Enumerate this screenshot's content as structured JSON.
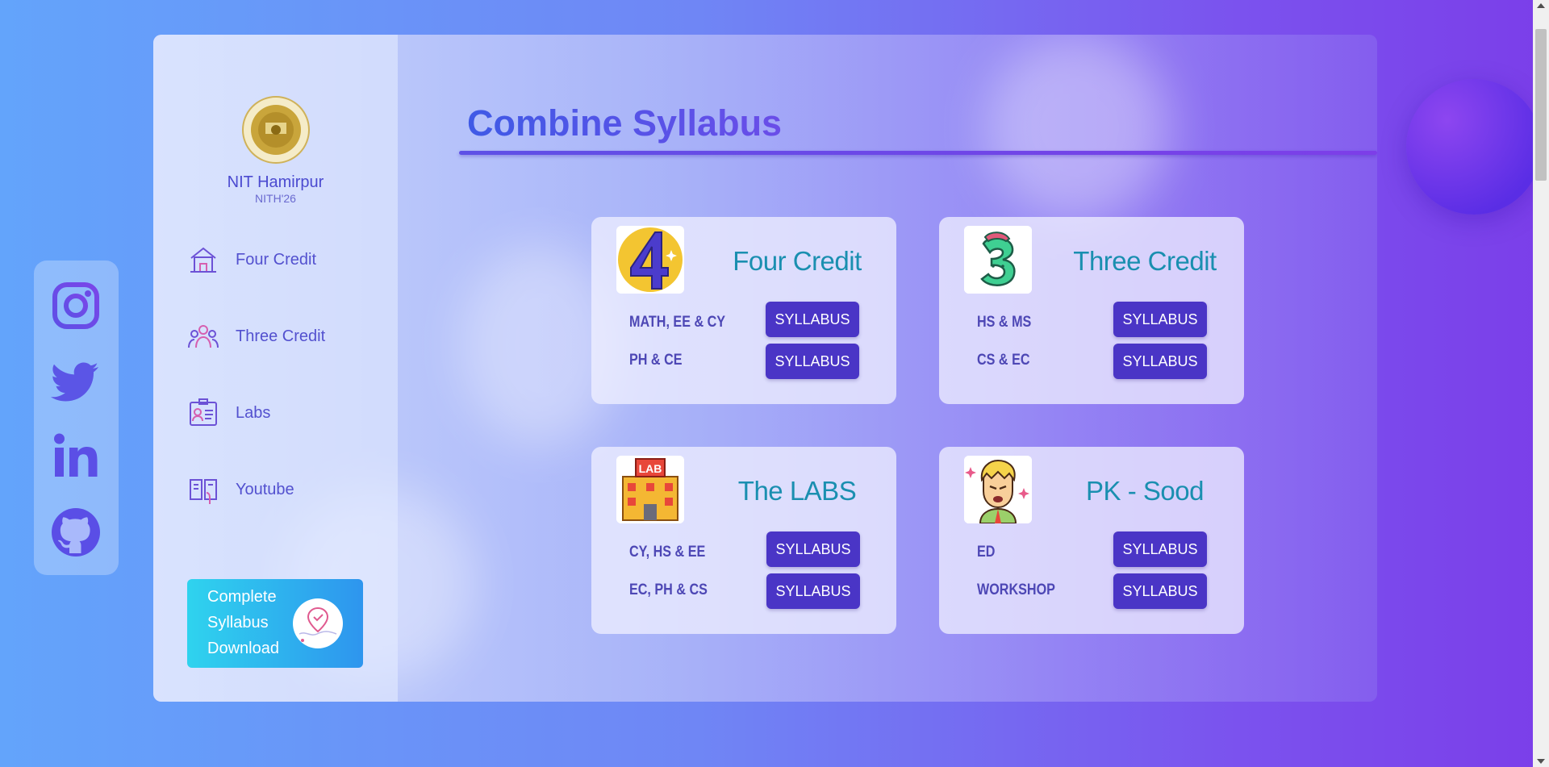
{
  "sidebar": {
    "brand_name": "NIT Hamirpur",
    "brand_sub": "NITH'26",
    "nav": [
      {
        "label": "Four Credit",
        "icon": "home-icon"
      },
      {
        "label": "Three Credit",
        "icon": "group-icon"
      },
      {
        "label": "Labs",
        "icon": "id-card-icon"
      },
      {
        "label": "Youtube",
        "icon": "book-icon"
      }
    ],
    "download": {
      "label_line1": "Complete",
      "label_line2": "Syllabus",
      "label_line3": "Download",
      "icon": "location-check-icon"
    }
  },
  "social": [
    {
      "name": "instagram-icon"
    },
    {
      "name": "twitter-icon"
    },
    {
      "name": "linkedin-icon"
    },
    {
      "name": "github-icon"
    }
  ],
  "main": {
    "title": "Combine Syllabus",
    "cards": [
      {
        "title": "Four Credit",
        "icon": "number-four-icon",
        "rows": [
          {
            "label": "MATH, EE & CY",
            "button": "SYLLABUS"
          },
          {
            "label": "PH & CE",
            "button": "SYLLABUS"
          }
        ]
      },
      {
        "title": "Three Credit",
        "icon": "number-three-icon",
        "rows": [
          {
            "label": "HS & MS",
            "button": "SYLLABUS"
          },
          {
            "label": "CS & EC",
            "button": "SYLLABUS"
          }
        ]
      },
      {
        "title": "The LABS",
        "icon": "lab-building-icon",
        "icon_text": "LAB",
        "rows": [
          {
            "label": "CY, HS & EE",
            "button": "SYLLABUS"
          },
          {
            "label": "EC, PH & CS",
            "button": "SYLLABUS"
          }
        ]
      },
      {
        "title": "PK - Sood",
        "icon": "angry-man-icon",
        "rows": [
          {
            "label": "ED",
            "button": "SYLLABUS"
          },
          {
            "label": "WORKSHOP",
            "button": "SYLLABUS"
          }
        ]
      }
    ]
  },
  "colors": {
    "accent": "#4a35c6",
    "title": "#4457e6",
    "card_title": "#1a8fb0",
    "download_bg": "#2fd3ee"
  }
}
